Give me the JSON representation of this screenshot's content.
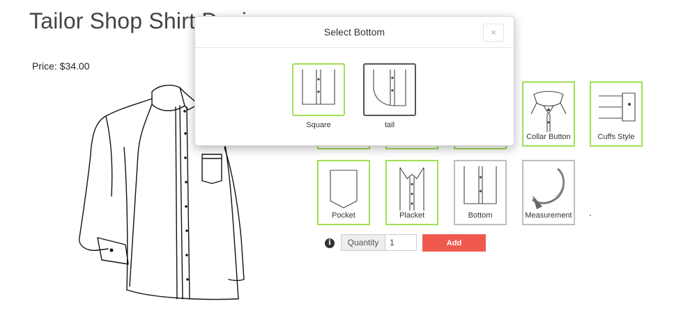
{
  "page": {
    "title": "Tailor Shop Shirt Design",
    "price": "Price: $34.00"
  },
  "options_top": [
    {
      "label": "Collar Button",
      "icon": "collar-button-icon"
    },
    {
      "label": "Cuffs Style",
      "icon": "cuffs-style-icon"
    }
  ],
  "options_bottom": [
    {
      "label": "Pocket",
      "icon": "pocket-icon"
    },
    {
      "label": "Placket",
      "icon": "placket-icon"
    },
    {
      "label": "Bottom",
      "icon": "shirt-bottom-icon"
    },
    {
      "label": "Measurement",
      "icon": "measuring-tape-icon"
    }
  ],
  "quantity": {
    "label": "Quantity",
    "value": "1"
  },
  "add_button": "Add",
  "modal": {
    "title": "Select Bottom",
    "close": "×",
    "options": [
      {
        "label": "Square",
        "selected": true
      },
      {
        "label": "tail",
        "selected": false
      }
    ]
  },
  "colors": {
    "selected_border": "#a0e050",
    "add_button": "#f05a4e"
  }
}
